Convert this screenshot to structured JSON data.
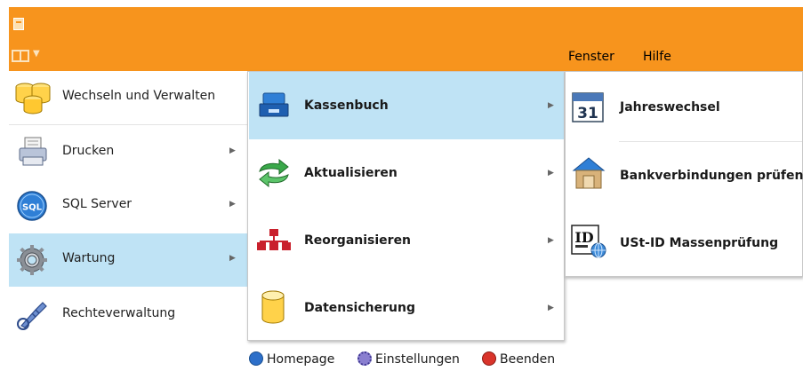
{
  "menubar": {
    "fenster": "Fenster",
    "hilfe": "Hilfe"
  },
  "app_menu": {
    "left_items": [
      {
        "label": "Wechseln und Verwalten",
        "icon": "database-cylinders-icon",
        "submenu": false
      },
      {
        "label": "Drucken",
        "icon": "printer-icon",
        "submenu": true
      },
      {
        "label": "SQL Server",
        "icon": "sql-server-icon",
        "submenu": true
      },
      {
        "label": "Wartung",
        "icon": "gear-icon",
        "submenu": true,
        "selected": true
      },
      {
        "label": "Rechteverwaltung",
        "icon": "key-icon",
        "submenu": false
      }
    ],
    "mid_items": [
      {
        "label": "Kassenbuch",
        "icon": "cash-register-icon",
        "submenu": true,
        "selected": true
      },
      {
        "label": "Aktualisieren",
        "icon": "refresh-arrows-icon",
        "submenu": true
      },
      {
        "label": "Reorganisieren",
        "icon": "hierarchy-icon",
        "submenu": true
      },
      {
        "label": "Datensicherung",
        "icon": "database-icon",
        "submenu": true
      }
    ],
    "right_items": [
      {
        "label": "Jahreswechsel",
        "icon": "calendar-31-icon"
      },
      {
        "label": "Bankverbindungen prüfen",
        "icon": "bank-icon"
      },
      {
        "label": "USt-ID Massenprüfung",
        "icon": "id-card-globe-icon"
      }
    ],
    "calendar_day": "31",
    "id_text": "ID",
    "sql_text": "SQL",
    "footer": {
      "homepage": "Homepage",
      "einstellungen": "Einstellungen",
      "beenden": "Beenden"
    }
  },
  "colors": {
    "accent": "#f7941d",
    "highlight": "#bfe3f5"
  }
}
